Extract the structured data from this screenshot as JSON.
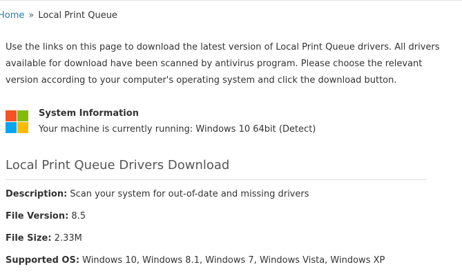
{
  "breadcrumb": {
    "home": "Home",
    "separator": "»",
    "current": "Local Print Queue"
  },
  "intro": {
    "text": "Use the links on this page to download the latest version of Local Print Queue drivers. All drivers available for download have been scanned by antivirus program. Please choose the relevant version according to your computer's operating system and click the download button."
  },
  "system_info": {
    "icon": "windows-logo-icon",
    "title": "System Information",
    "running": "Your machine is currently running: Windows 10 64bit (Detect)"
  },
  "download_section": {
    "title": "Local Print Queue Drivers Download",
    "description_label": "Description:",
    "description_value": " Scan your system for out-of-date and missing drivers",
    "version_label": "File Version:",
    "version_value": " 8.5",
    "size_label": "File Size:",
    "size_value": " 2.33M",
    "os_label": "Supported OS:",
    "os_value": " Windows 10, Windows 8.1, Windows 7, Windows Vista, Windows XP"
  },
  "colors": {
    "link": "#2a7ab0",
    "text": "#333333",
    "win_red": "#f35325",
    "win_green": "#81bc06",
    "win_blue": "#05a6f0",
    "win_yellow": "#ffba08"
  }
}
